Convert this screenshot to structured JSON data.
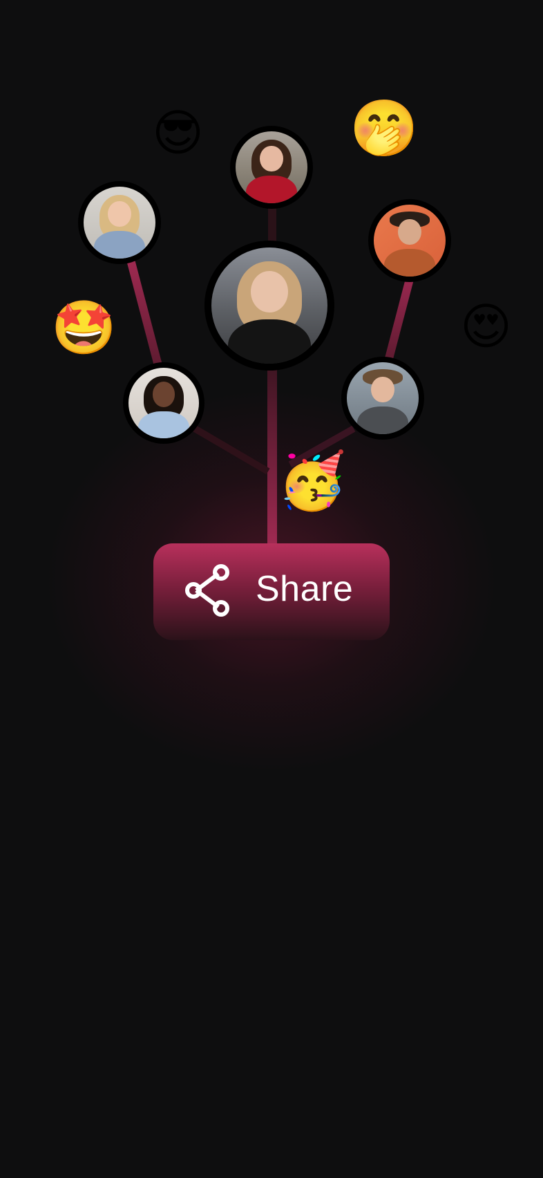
{
  "colors": {
    "background": "#0e0e0f",
    "accent": "#b8305c",
    "branch": "#8a2545"
  },
  "share_button": {
    "label": "Share",
    "icon": "share-icon"
  },
  "avatars": [
    {
      "name": "center-avatar",
      "description": "woman-black-top"
    },
    {
      "name": "top-avatar",
      "description": "woman-red-top"
    },
    {
      "name": "upper-left-avatar",
      "description": "woman-denim-jacket"
    },
    {
      "name": "upper-right-avatar",
      "description": "man-orange-shirt"
    },
    {
      "name": "lower-left-avatar",
      "description": "woman-blue-crop-top"
    },
    {
      "name": "lower-right-avatar",
      "description": "man-grey-blazer"
    }
  ],
  "emojis": {
    "sunglasses": "😎",
    "hand_over_mouth": "🤭",
    "rolling_star": "🤩",
    "heart_eyes": "😍",
    "partying": "🥳"
  }
}
